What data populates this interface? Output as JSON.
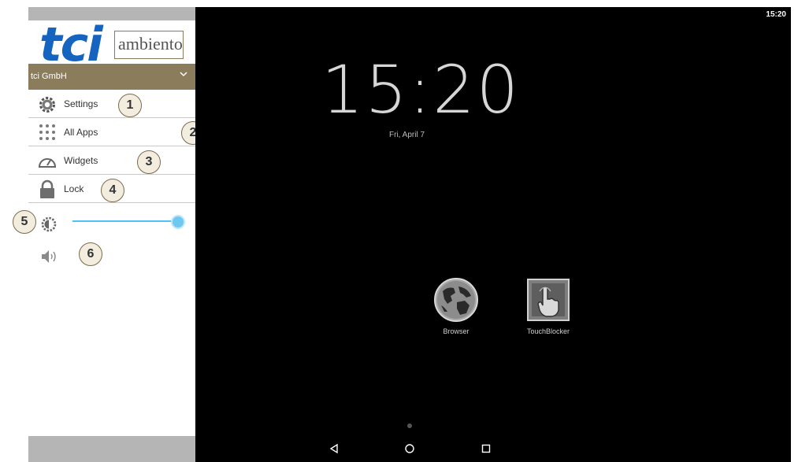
{
  "drawer": {
    "logo_primary": "tci",
    "logo_secondary": "ambiento",
    "account": "tci GmbH",
    "items": [
      {
        "label": "Settings",
        "icon": "gear-icon",
        "badge": "1"
      },
      {
        "label": "All Apps",
        "icon": "app-grid-icon",
        "badge": "2"
      },
      {
        "label": "Widgets",
        "icon": "gauge-icon",
        "badge": "3"
      },
      {
        "label": "Lock",
        "icon": "lock-icon",
        "badge": "4"
      }
    ],
    "brightness": {
      "icon": "brightness-icon",
      "badge": "5",
      "level_fraction": 1.0
    },
    "volume": {
      "icon": "volume-icon",
      "badge": "6"
    }
  },
  "launcher": {
    "status_time": "15:20",
    "clock": "15:20",
    "date": "Fri, April 7",
    "apps": [
      {
        "label": "Browser",
        "icon": "globe-icon"
      },
      {
        "label": "TouchBlocker",
        "icon": "touch-hand-icon"
      }
    ]
  },
  "navbar": {
    "back": "back-icon",
    "home": "home-icon",
    "recents": "recents-icon"
  },
  "colors": {
    "brand_blue": "#1565c0",
    "account_bar": "#8b7d5c",
    "slider_accent": "#4fc3f7",
    "badge_border": "#7a6a4a"
  }
}
